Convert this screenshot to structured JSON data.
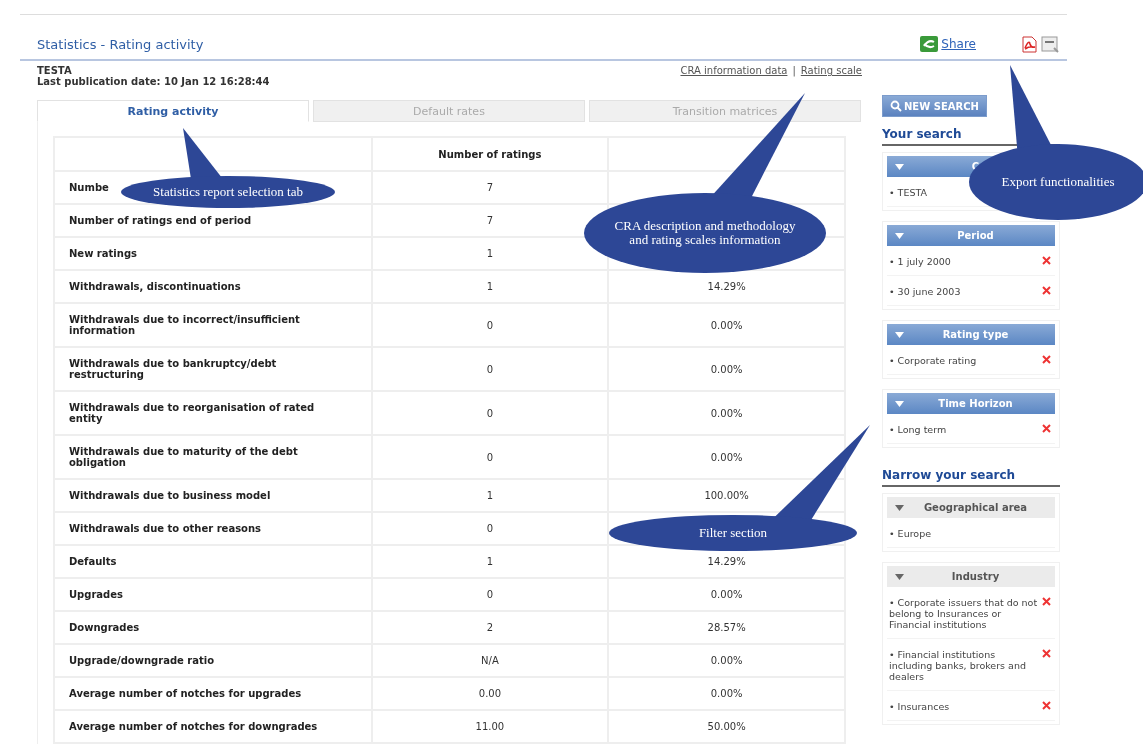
{
  "page_title": "Statistics - Rating activity",
  "share": {
    "label": "Share"
  },
  "entity": "TESTA",
  "publication": "Last publication date: 10 Jan 12 16:28:44",
  "links": [
    "CRA information data",
    "Rating scale"
  ],
  "link_separator": "|",
  "tabs": [
    {
      "label": "Rating activity",
      "selected": true
    },
    {
      "label": "Default rates",
      "selected": false
    },
    {
      "label": "Transition matrices",
      "selected": false
    }
  ],
  "table": {
    "columns": [
      "",
      "Number of ratings",
      ""
    ],
    "rows": [
      [
        "Numbe",
        "7",
        null
      ],
      [
        "Number of ratings end of period",
        "7",
        null
      ],
      [
        "New ratings",
        "1",
        null
      ],
      [
        "Withdrawals, discontinuations",
        "1",
        "14.29%"
      ],
      [
        "Withdrawals due to incorrect/insufficient information",
        "0",
        "0.00%"
      ],
      [
        "Withdrawals due to bankruptcy/debt restructuring",
        "0",
        "0.00%"
      ],
      [
        "Withdrawals due to reorganisation of rated entity",
        "0",
        "0.00%"
      ],
      [
        "Withdrawals due to maturity of the debt obligation",
        "0",
        "0.00%"
      ],
      [
        "Withdrawals due to business model",
        "1",
        "100.00%"
      ],
      [
        "Withdrawals due to other reasons",
        "0",
        null
      ],
      [
        "Defaults",
        "1",
        "14.29%"
      ],
      [
        "Upgrades",
        "0",
        "0.00%"
      ],
      [
        "Downgrades",
        "2",
        "28.57%"
      ],
      [
        "Upgrade/downgrade ratio",
        "N/A",
        "0.00%"
      ],
      [
        "Average number of notches for upgrades",
        "0.00",
        "0.00%"
      ],
      [
        "Average number of notches for downgrades",
        "11.00",
        "50.00%"
      ]
    ]
  },
  "sidebar": {
    "new_search": "NEW SEARCH",
    "your_search": {
      "heading": "Your search",
      "groups": [
        {
          "title": "C",
          "items": [
            {
              "label": "• TESTA",
              "removable": false
            }
          ]
        },
        {
          "title": "Period",
          "items": [
            {
              "label": "• 1 july 2000",
              "removable": true
            },
            {
              "label": "• 30 june 2003",
              "removable": true
            }
          ]
        },
        {
          "title": "Rating type",
          "items": [
            {
              "label": "• Corporate rating",
              "removable": true
            }
          ]
        },
        {
          "title": "Time Horizon",
          "items": [
            {
              "label": "• Long term",
              "removable": true
            }
          ]
        }
      ]
    },
    "narrow_your_search": {
      "heading": "Narrow your search",
      "groups": [
        {
          "title": "Geographical area",
          "items": [
            {
              "label": "• Europe",
              "removable": false
            }
          ]
        },
        {
          "title": "Industry",
          "items": [
            {
              "label": "• Corporate issuers that do not belong to Insurances or Financial institutions",
              "removable": true
            },
            {
              "label": "• Financial institutions including banks, brokers and dealers",
              "removable": true
            },
            {
              "label": "• Insurances",
              "removable": true
            }
          ]
        }
      ]
    }
  },
  "callouts": [
    {
      "text": "Statistics report selection tab",
      "kind": "left"
    },
    {
      "text": "CRA description and methodology and rating scales information",
      "kind": "cra"
    },
    {
      "text": "Export functionalities",
      "kind": "export"
    },
    {
      "text": "Filter section",
      "kind": "filter"
    }
  ]
}
